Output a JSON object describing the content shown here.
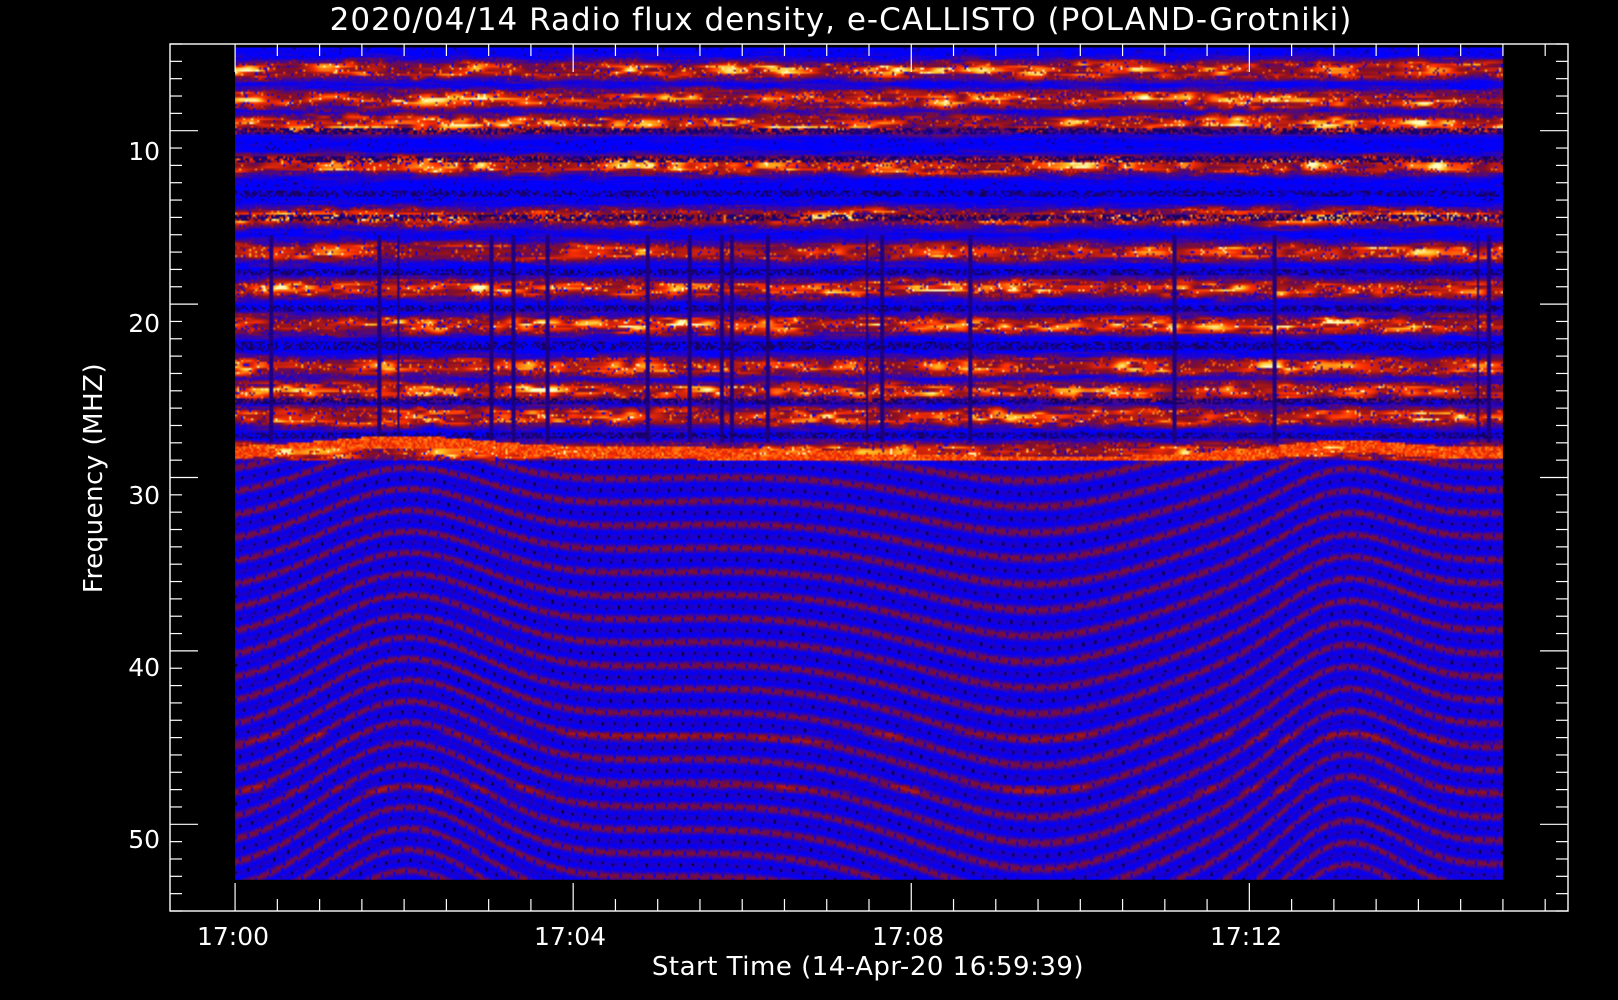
{
  "chart_data": {
    "type": "heatmap",
    "title": "2020/04/14  Radio flux density, e-CALLISTO (POLAND-Grotniki)",
    "xlabel": "Start Time (14-Apr-20 16:59:39)",
    "ylabel": "Frequency (MHZ)",
    "x_tick_labels": [
      "17:00",
      "17:04",
      "17:08",
      "17:12"
    ],
    "x_tick_minutes": [
      0,
      4,
      8,
      12
    ],
    "x_range_minutes": [
      -0.77,
      15.77
    ],
    "data_extent_minutes": [
      0,
      15
    ],
    "y_tick_labels": [
      "10",
      "20",
      "30",
      "40",
      "50"
    ],
    "y_tick_values": [
      10,
      20,
      30,
      40,
      50
    ],
    "ylim": [
      5,
      55
    ],
    "y_axis_inverted": true,
    "data_extent_mhz": [
      5.2,
      53.2
    ],
    "colormap": [
      "#000000",
      "#2800b4",
      "#0000ff",
      "#8a1020",
      "#ff3000",
      "#ffc020",
      "#ffffc0"
    ],
    "background_color": "#000000",
    "axis_color": "#ffffff",
    "strong_emission_bands_mhz": [
      6.5,
      8.2,
      9.6,
      12.0,
      15.0,
      17.0,
      19.1,
      21.2,
      23.6,
      25.0,
      26.5,
      28.5
    ],
    "weak_bands_mhz": [
      45.0,
      48.0
    ],
    "interference_frequency_mhz": 29,
    "arc_minima_minutes": [
      2.0,
      13.1
    ],
    "arc_peak_minutes": 9.6
  }
}
